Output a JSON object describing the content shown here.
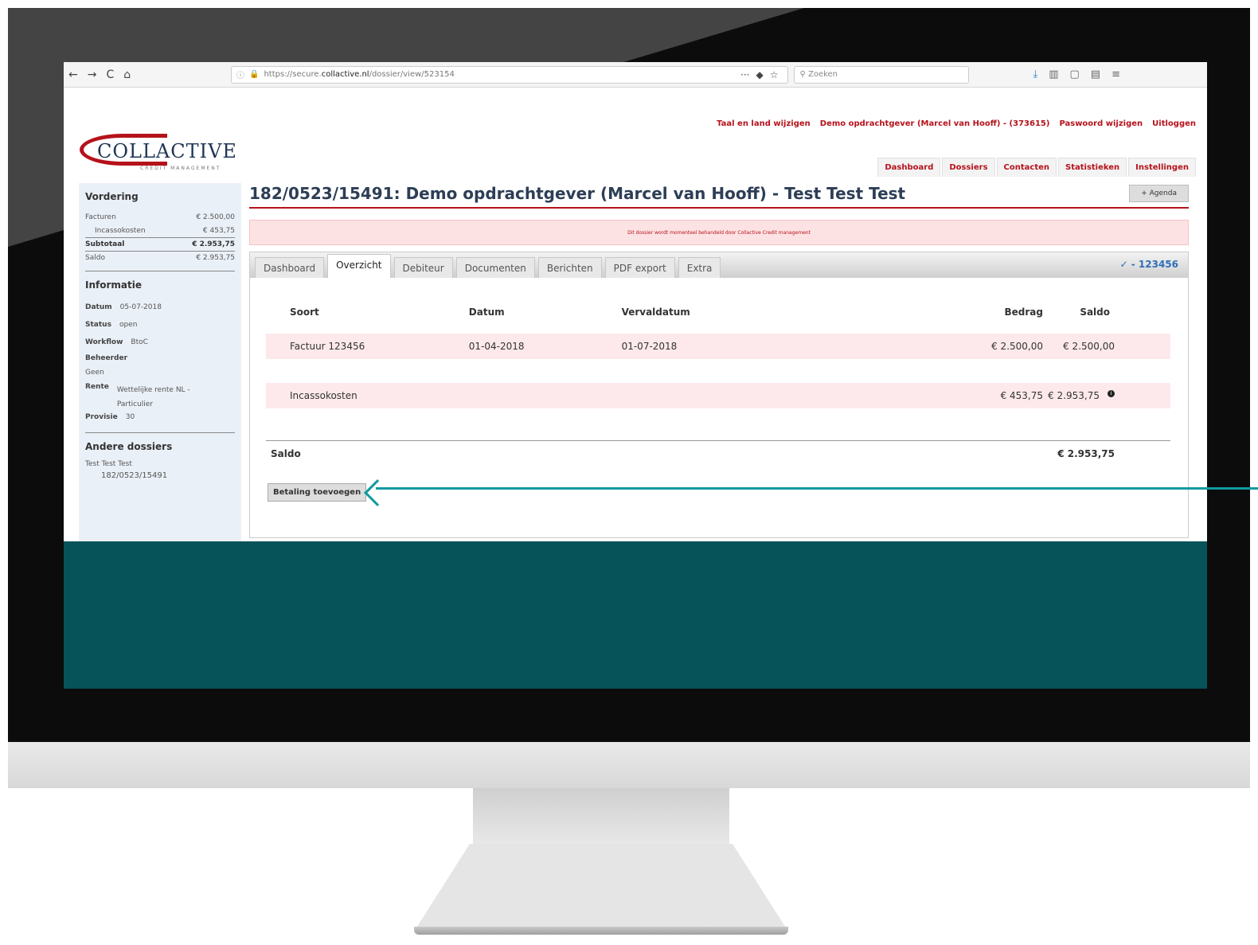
{
  "browser": {
    "url_prefix": "https://secure.",
    "url_domain": "collactive.nl",
    "url_path": "/dossier/view/523154",
    "search_placeholder": "Zoeken",
    "nav_back": "←",
    "nav_forward": "→",
    "nav_reload": "C",
    "nav_home": "⌂"
  },
  "header": {
    "logo_name": "COLLACTIVE",
    "logo_sub": "CREDIT MANAGEMENT",
    "links": [
      "Taal en land wijzigen",
      "Demo opdrachtgever (Marcel van Hooff) - (373615)",
      "Paswoord wijzigen",
      "Uitloggen"
    ],
    "nav": [
      "Dashboard",
      "Dossiers",
      "Contacten",
      "Statistieken",
      "Instellingen"
    ]
  },
  "sidebar": {
    "vordering_title": "Vordering",
    "facturen_label": "Facturen",
    "facturen_value": "€ 2.500,00",
    "incasso_label": "Incassokosten",
    "incasso_value": "€ 453,75",
    "subtotaal_label": "Subtotaal",
    "subtotaal_value": "€ 2.953,75",
    "saldo_label": "Saldo",
    "saldo_value": "€ 2.953,75",
    "informatie_title": "Informatie",
    "datum_label": "Datum",
    "datum_value": "05-07-2018",
    "status_label": "Status",
    "status_value": "open",
    "workflow_label": "Workflow",
    "workflow_value": "BtoC",
    "beheerder_label": "Beheerder",
    "beheerder_value": "Geen",
    "rente_label": "Rente",
    "rente_value": "Wettelijke rente NL - Particulier",
    "provisie_label": "Provisie",
    "provisie_value": "30",
    "andere_title": "Andere dossiers",
    "andere_name": "Test Test Test",
    "andere_ref": "182/0523/15491"
  },
  "main": {
    "title": "182/0523/15491: Demo opdrachtgever (Marcel van Hooff) - Test Test Test",
    "agenda_button": "+ Agenda",
    "alert": "Dit dossier wordt momenteel behandeld door Collactive Credit management",
    "tabs": [
      "Dashboard",
      "Overzicht",
      "Debiteur",
      "Documenten",
      "Berichten",
      "PDF export",
      "Extra"
    ],
    "reference": "✓ - 123456",
    "table_headers": [
      "Soort",
      "Datum",
      "Vervaldatum",
      "Bedrag",
      "Saldo"
    ],
    "rows": [
      {
        "soort": "Factuur 123456",
        "datum": "01-04-2018",
        "vervaldatum": "01-07-2018",
        "bedrag": "€ 2.500,00",
        "saldo": "€ 2.500,00"
      },
      {
        "soort": "Incassokosten",
        "datum": "",
        "vervaldatum": "",
        "bedrag": "€ 453,75",
        "saldo": "€ 2.953,75"
      }
    ],
    "saldo_label": "Saldo",
    "saldo_value": "€ 2.953,75",
    "pay_button": "Betaling toevoegen"
  },
  "colors": {
    "brand_red": "#b5121b",
    "navy": "#1f3554",
    "teal": "#06535a",
    "arrow": "#0e9a9f"
  }
}
